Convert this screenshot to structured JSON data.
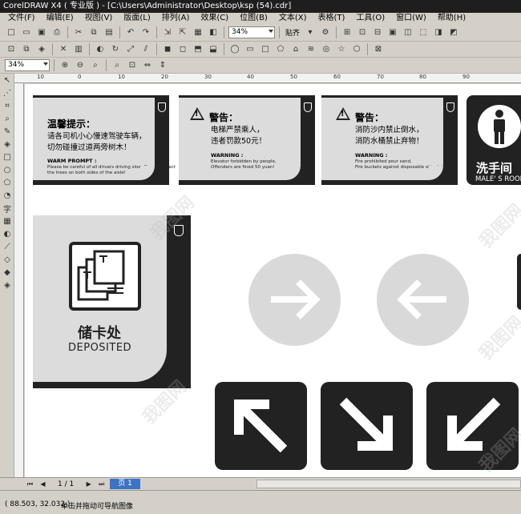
{
  "window": {
    "title": "CorelDRAW X4 ( 专业版 ) - [C:\\Users\\Administrator\\Desktop\\ksp (54).cdr]"
  },
  "menu": [
    "文件(F)",
    "编辑(E)",
    "视图(V)",
    "版面(L)",
    "排列(A)",
    "效果(C)",
    "位图(B)",
    "文本(X)",
    "表格(T)",
    "工具(O)",
    "窗口(W)",
    "帮助(H)"
  ],
  "toolbar": {
    "zoom_value": "34%",
    "snap_label": "贴齐"
  },
  "property_bar": {
    "zoom_value": "34%"
  },
  "ruler": {
    "ticks": [
      "10",
      "0",
      "10",
      "20",
      "30",
      "40",
      "50",
      "60",
      "70",
      "80",
      "90"
    ]
  },
  "signs": {
    "tip": {
      "title": "温馨提示：",
      "body": "请各司机小心慢速驾驶车辆，\n切勿碰撞过道两旁树木！",
      "en_title": "WARM PROMPT :",
      "en_body": "Please be careful of all drivers driving slow. Do not impact\nthe trees on both sides of the aisle!"
    },
    "elevator": {
      "title": "警告：",
      "body": "电梯严禁乘人，\n违者罚款50元！",
      "en_title": "WARNING :",
      "en_body": "Elevator forbidden by people,\nOffenders are fined 50 yuan!"
    },
    "fire": {
      "title": "警告：",
      "body": "消防沙内禁止倒水，\n消防水桶禁止弃物！",
      "en_title": "WARNING :",
      "en_body": "Fire prohibited pour sand,\nFire buckets against disposable objects!"
    },
    "restroom": {
      "cn": "洗手间",
      "en": "MALE' S ROOM"
    },
    "deposit": {
      "cn": "储卡处",
      "en": "DEPOSITED"
    }
  },
  "watermark": "我图网",
  "pagebar": {
    "count": "1 / 1",
    "tab": "页 1"
  },
  "status": {
    "coords": "( 88.503, 32.032 )",
    "hint": "单击并拖动可导航图像"
  }
}
